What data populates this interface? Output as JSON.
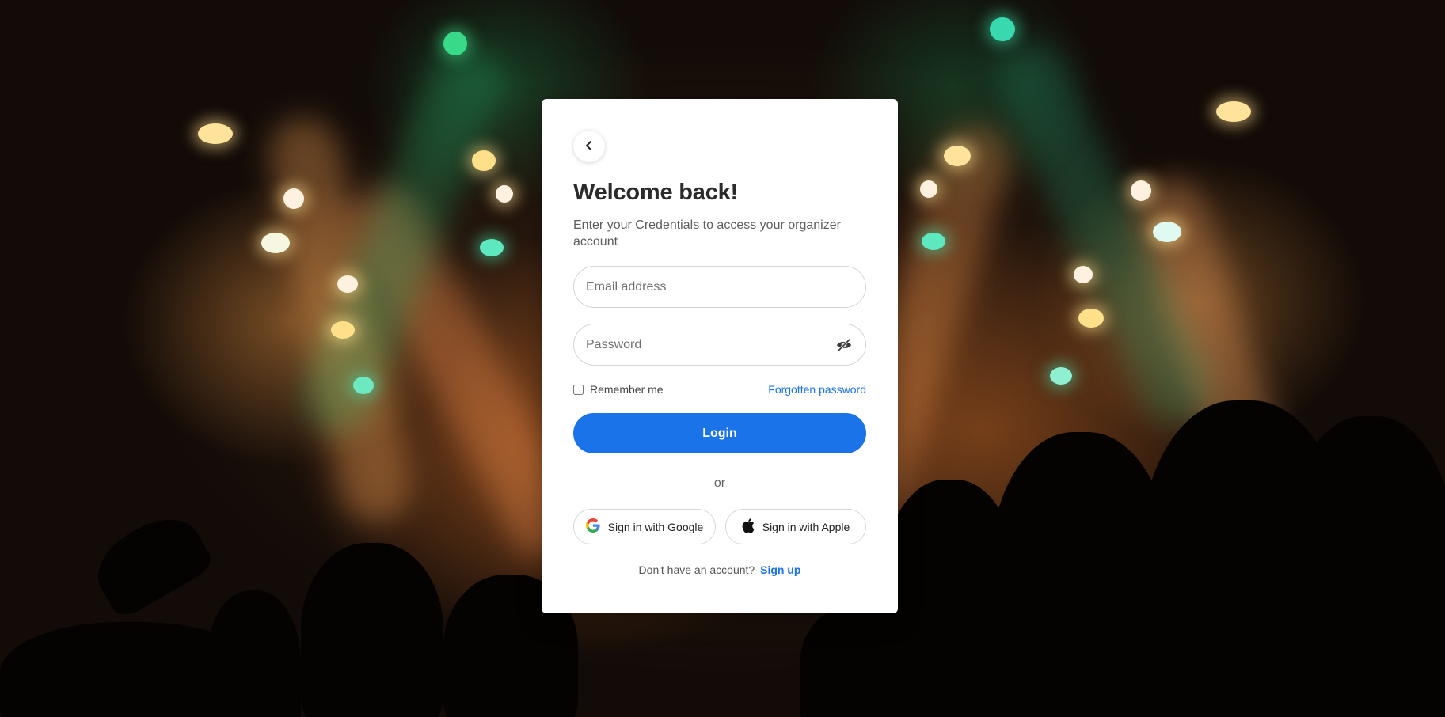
{
  "card": {
    "back_icon": "chevron-left-icon",
    "title": "Welcome back!",
    "subtitle": "Enter your Credentials to access your organizer account"
  },
  "form": {
    "email_placeholder": "Email address",
    "email_value": "",
    "password_placeholder": "Password",
    "password_value": "",
    "password_toggle_icon": "eye-off-icon",
    "remember_label": "Remember me",
    "remember_checked": false,
    "forgot_label": "Forgotten password",
    "login_label": "Login"
  },
  "divider": {
    "label": "or"
  },
  "social": {
    "google_label": "Sign in with Google",
    "google_icon": "google-icon",
    "apple_label": "Sign in with Apple",
    "apple_icon": "apple-icon"
  },
  "footer": {
    "prompt": "Don't have an account?",
    "signup_label": "Sign up"
  },
  "colors": {
    "accent": "#1a73e8",
    "card_background": "#ffffff",
    "title_text": "#2b2b2b"
  }
}
